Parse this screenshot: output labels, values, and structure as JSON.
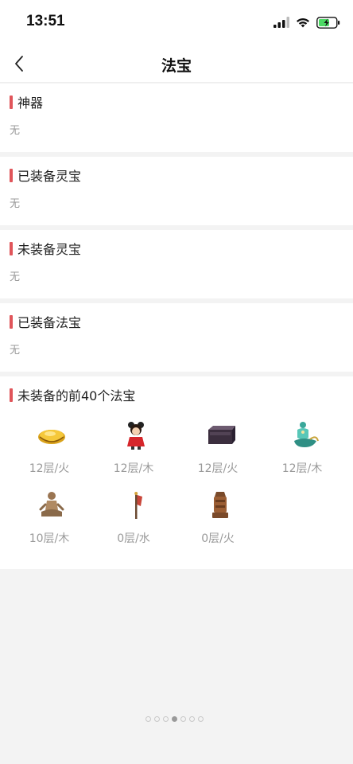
{
  "status": {
    "time": "13:51"
  },
  "nav": {
    "title": "法宝"
  },
  "sections": [
    {
      "title": "神器",
      "empty": "无"
    },
    {
      "title": "已装备灵宝",
      "empty": "无"
    },
    {
      "title": "未装备灵宝",
      "empty": "无"
    },
    {
      "title": "已装备法宝",
      "empty": "无"
    }
  ],
  "unequipped": {
    "title": "未装备的前40个法宝",
    "items": [
      {
        "label": "12层/火",
        "icon": "gold-ingot-icon"
      },
      {
        "label": "12层/木",
        "icon": "doll-figure-icon"
      },
      {
        "label": "12层/火",
        "icon": "dark-box-icon"
      },
      {
        "label": "12层/木",
        "icon": "lamp-genie-icon"
      },
      {
        "label": "10层/木",
        "icon": "sitting-figure-icon"
      },
      {
        "label": "0层/水",
        "icon": "flag-staff-icon"
      },
      {
        "label": "0层/火",
        "icon": "bronze-seal-icon"
      }
    ]
  },
  "pager": {
    "count": 7,
    "active": 3
  },
  "colors": {
    "accent": "#e0555a",
    "muted": "#999999",
    "background": "#f3f3f3"
  }
}
